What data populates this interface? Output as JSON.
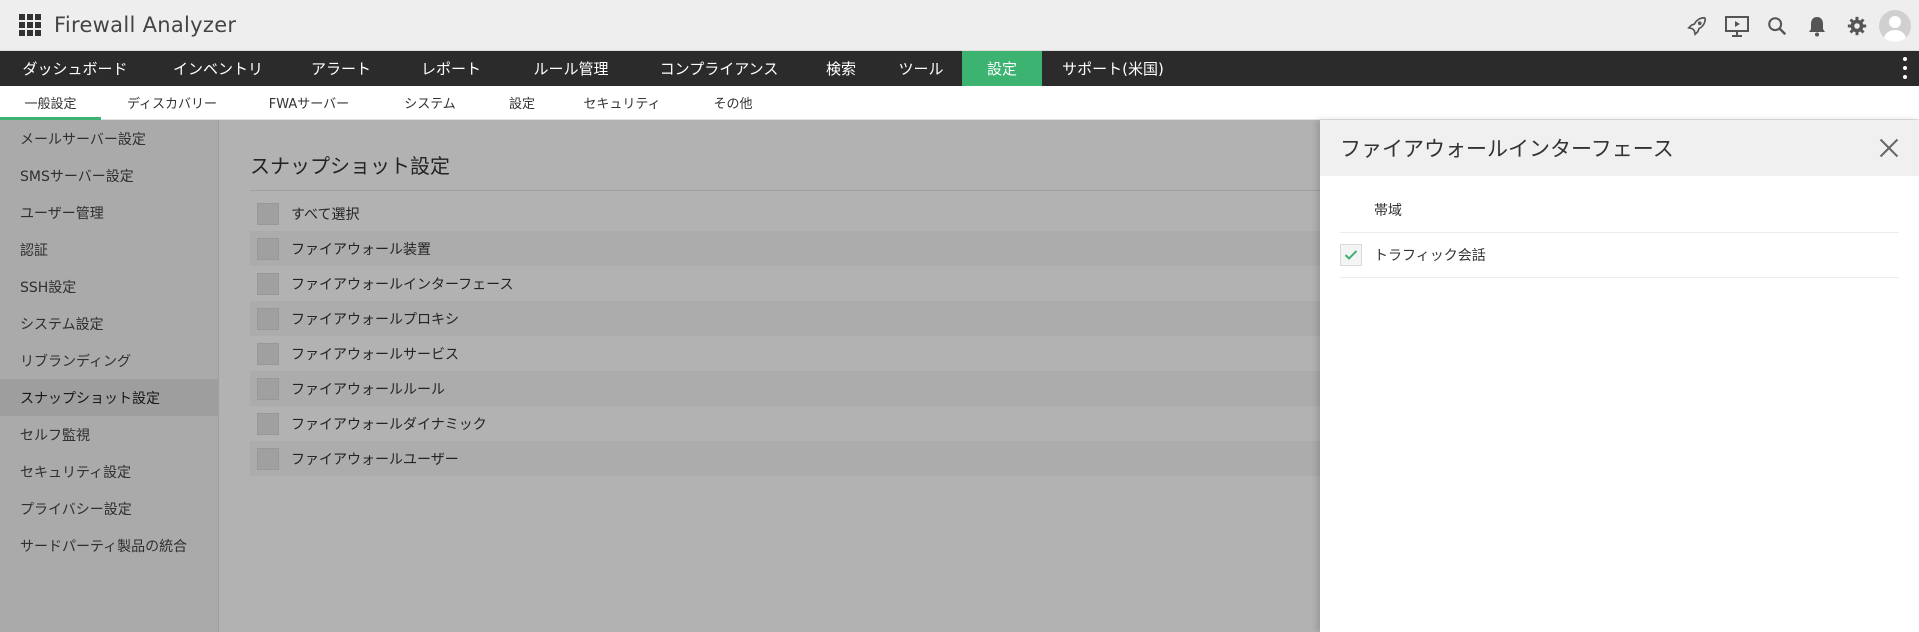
{
  "app": {
    "title": "Firewall Analyzer"
  },
  "header_icons": [
    "rocket-icon",
    "presentation-icon",
    "search-icon",
    "bell-icon",
    "gear-icon",
    "user-avatar-icon"
  ],
  "main_nav": {
    "items": [
      {
        "label": "ダッシュボード",
        "active": false
      },
      {
        "label": "インベントリ",
        "active": false
      },
      {
        "label": "アラート",
        "active": false
      },
      {
        "label": "レポート",
        "active": false
      },
      {
        "label": "ルール管理",
        "active": false
      },
      {
        "label": "コンプライアンス",
        "active": false
      },
      {
        "label": "検索",
        "active": false
      },
      {
        "label": "ツール",
        "active": false
      },
      {
        "label": "設定",
        "active": true
      },
      {
        "label": "サポート(米国)",
        "active": false
      }
    ],
    "active_color": "#3cb371"
  },
  "sub_nav": {
    "items": [
      {
        "label": "一般設定",
        "active": true
      },
      {
        "label": "ディスカバリー",
        "active": false
      },
      {
        "label": "FWAサーバー",
        "active": false
      },
      {
        "label": "システム",
        "active": false
      },
      {
        "label": "設定",
        "active": false
      },
      {
        "label": "セキュリティ",
        "active": false
      },
      {
        "label": "その他",
        "active": false
      }
    ]
  },
  "sidebar": {
    "items": [
      {
        "label": "メールサーバー設定",
        "active": false
      },
      {
        "label": "SMSサーバー設定",
        "active": false
      },
      {
        "label": "ユーザー管理",
        "active": false
      },
      {
        "label": "認証",
        "active": false
      },
      {
        "label": "SSH設定",
        "active": false
      },
      {
        "label": "システム設定",
        "active": false
      },
      {
        "label": "リブランディング",
        "active": false
      },
      {
        "label": "スナップショット設定",
        "active": true
      },
      {
        "label": "セルフ監視",
        "active": false
      },
      {
        "label": "セキュリティ設定",
        "active": false
      },
      {
        "label": "プライバシー設定",
        "active": false
      },
      {
        "label": "サードパーティ製品の統合",
        "active": false
      }
    ]
  },
  "content": {
    "title": "スナップショット設定",
    "options": [
      {
        "label": "すべて選択",
        "checked": false
      },
      {
        "label": "ファイアウォール装置",
        "checked": false
      },
      {
        "label": "ファイアウォールインターフェース",
        "checked": false
      },
      {
        "label": "ファイアウォールプロキシ",
        "checked": false
      },
      {
        "label": "ファイアウォールサービス",
        "checked": false
      },
      {
        "label": "ファイアウォールルール",
        "checked": false
      },
      {
        "label": "ファイアウォールダイナミック",
        "checked": false
      },
      {
        "label": "ファイアウォールユーザー",
        "checked": false
      }
    ]
  },
  "panel": {
    "title": "ファイアウォールインターフェース",
    "rows": [
      {
        "label": "帯域",
        "checked": false
      },
      {
        "label": "トラフィック会話",
        "checked": true
      }
    ],
    "check_color": "#3cb371"
  }
}
